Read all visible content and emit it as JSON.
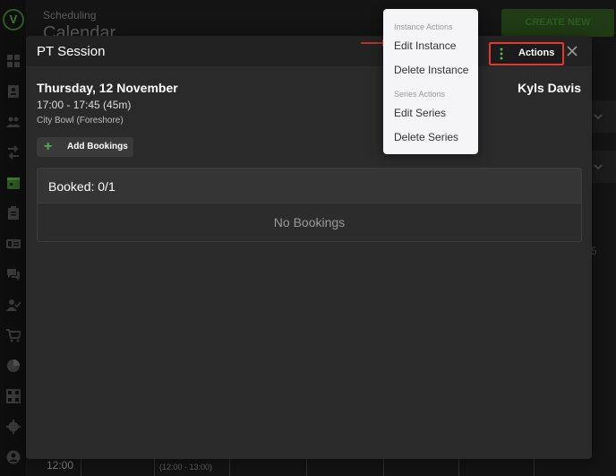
{
  "background": {
    "subtitle": "Scheduling",
    "title": "Calendar",
    "create_button": "CREATE NEW",
    "list_fragment": "ist",
    "number_fragment": "5",
    "time_label": "12:00",
    "slot_label": "(12:00 - 13:00)"
  },
  "sidebar": {
    "logo": "V",
    "icons": [
      "dashboard-icon",
      "contacts-icon",
      "people-icon",
      "swap-icon",
      "calendar-icon",
      "clipboard-icon",
      "id-card-icon",
      "chat-icon",
      "user-check-icon",
      "cart-icon",
      "pie-chart-icon",
      "grid-icon",
      "gear-icon",
      "account-icon"
    ]
  },
  "modal": {
    "title": "PT Session",
    "actions_label": "Actions",
    "date": "Thursday, 12 November",
    "time": "17:00 - 17:45 (45m)",
    "location": "City Bowl (Foreshore)",
    "staff": "Kyls Davis",
    "add_bookings_label": "Add Bookings",
    "booked_title": "Booked: 0/1",
    "empty_message": "No Bookings"
  },
  "dropdown": {
    "instance_section": "Instance Actions",
    "edit_instance": "Edit Instance",
    "delete_instance": "Delete Instance",
    "series_section": "Series Actions",
    "edit_series": "Edit Series",
    "delete_series": "Delete Series"
  },
  "colors": {
    "highlight": "#e03a2f",
    "accent_green": "#4caf50",
    "modal_bg": "#2a2a2a"
  }
}
